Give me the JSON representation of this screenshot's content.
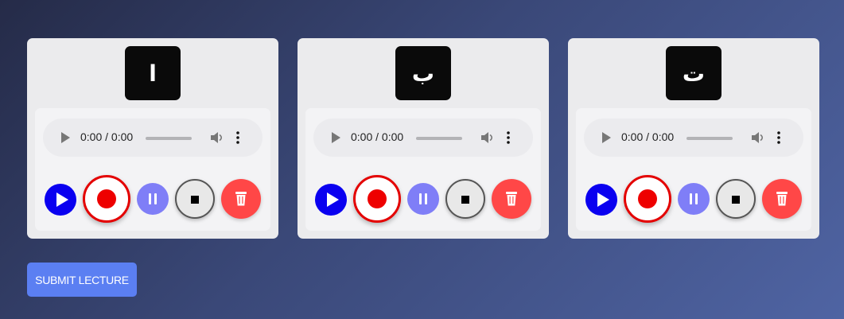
{
  "cards": [
    {
      "letter": "ا",
      "audio": {
        "time": "0:00 / 0:00"
      }
    },
    {
      "letter": "ب",
      "audio": {
        "time": "0:00 / 0:00"
      }
    },
    {
      "letter": "ت",
      "audio": {
        "time": "0:00 / 0:00"
      }
    }
  ],
  "controls": {
    "icons": [
      "play-icon",
      "record-icon",
      "pause-icon",
      "stop-icon",
      "trash-icon"
    ]
  },
  "colors": {
    "play": "#0a00f0",
    "record": "#ee0000",
    "pause": "#7f7ef7",
    "delete": "#ff4747",
    "submit": "#5b7ff2"
  },
  "submit_label": "SUBMIT LECTURE"
}
